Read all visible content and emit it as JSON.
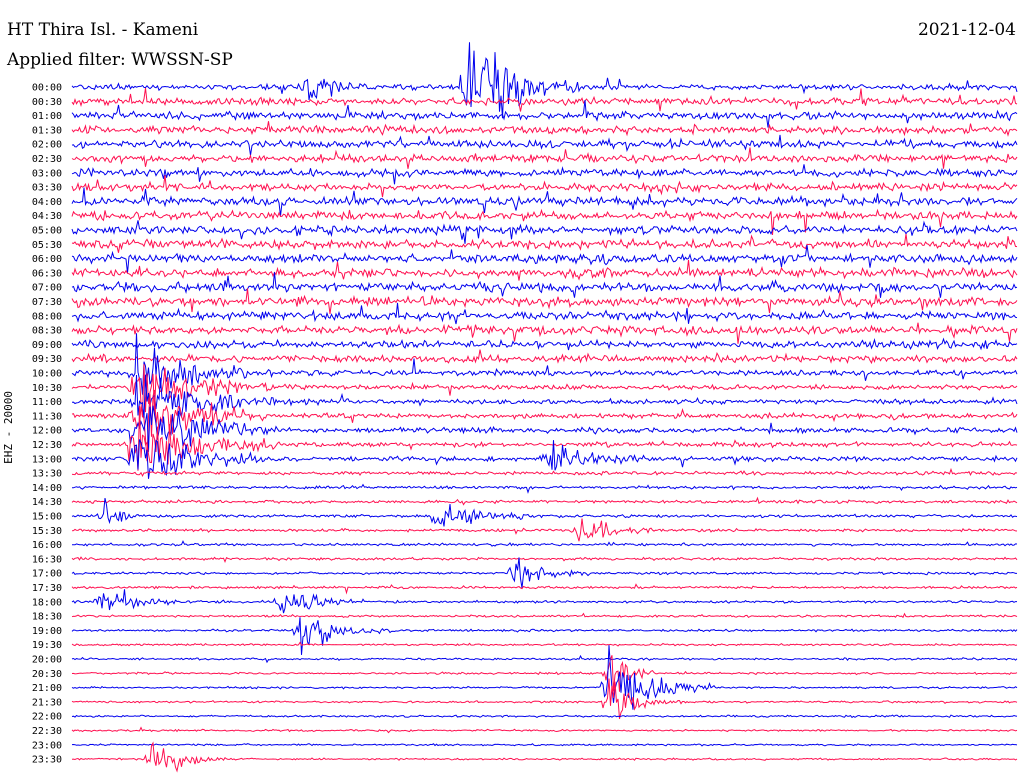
{
  "header": {
    "station": "HT Thira Isl. - Kameni",
    "filter": "Applied filter: WWSSN-SP",
    "date": "2021-12-04",
    "channel_label": "EHZ - 20000"
  },
  "colors": {
    "trace_a": "#0000ee",
    "trace_b": "#ff1050",
    "text": "#000000",
    "background": "#ffffff"
  },
  "chart_data": {
    "type": "line",
    "title": "HT Thira Isl. - Kameni",
    "subtitle": "Applied filter: WWSSN-SP",
    "ylabel": "EHZ - 20000",
    "xlabel": "",
    "row_labels": [
      "00:00",
      "00:30",
      "01:00",
      "01:30",
      "02:00",
      "02:30",
      "03:00",
      "03:30",
      "04:00",
      "04:30",
      "05:00",
      "05:30",
      "06:00",
      "06:30",
      "07:00",
      "07:30",
      "08:00",
      "08:30",
      "09:00",
      "09:30",
      "10:00",
      "10:30",
      "11:00",
      "11:30",
      "12:00",
      "12:30",
      "13:00",
      "13:30",
      "14:00",
      "14:30",
      "15:00",
      "15:30",
      "16:00",
      "16:30",
      "17:00",
      "17:30",
      "18:00",
      "18:30",
      "19:00",
      "19:30",
      "20:00",
      "20:30",
      "21:00",
      "21:30",
      "22:00",
      "22:30",
      "23:00",
      "23:30"
    ],
    "series_colors_alternating": [
      "#0000ee",
      "#ff1050"
    ],
    "noise_level": [
      0.55,
      0.7,
      0.75,
      0.75,
      0.75,
      0.75,
      0.75,
      0.75,
      0.85,
      0.85,
      0.85,
      0.85,
      0.85,
      0.85,
      0.85,
      0.85,
      0.8,
      0.8,
      0.75,
      0.7,
      0.55,
      0.45,
      0.5,
      0.5,
      0.5,
      0.45,
      0.45,
      0.35,
      0.3,
      0.3,
      0.28,
      0.28,
      0.25,
      0.25,
      0.25,
      0.25,
      0.25,
      0.22,
      0.22,
      0.2,
      0.2,
      0.2,
      0.2,
      0.2,
      0.2,
      0.18,
      0.18,
      0.18
    ],
    "events": [
      {
        "row": 0,
        "minute": 12.5,
        "amplitude": 6,
        "duration_min": 1.2
      },
      {
        "row": 0,
        "minute": 7.5,
        "amplitude": 2.5,
        "duration_min": 0.6
      },
      {
        "row": 20,
        "minute": 2.0,
        "amplitude": 3,
        "duration_min": 1.5
      },
      {
        "row": 21,
        "minute": 2.0,
        "amplitude": 3.5,
        "duration_min": 1.5
      },
      {
        "row": 22,
        "minute": 2.0,
        "amplitude": 4,
        "duration_min": 1.5
      },
      {
        "row": 23,
        "minute": 2.0,
        "amplitude": 4,
        "duration_min": 1.5
      },
      {
        "row": 24,
        "minute": 2.0,
        "amplitude": 4.5,
        "duration_min": 1.5
      },
      {
        "row": 25,
        "minute": 2.0,
        "amplitude": 4.5,
        "duration_min": 1.5
      },
      {
        "row": 26,
        "minute": 2.0,
        "amplitude": 3.5,
        "duration_min": 1.5
      },
      {
        "row": 26,
        "minute": 15.0,
        "amplitude": 2,
        "duration_min": 1.2
      },
      {
        "row": 30,
        "minute": 11.5,
        "amplitude": 2,
        "duration_min": 1.0
      },
      {
        "row": 30,
        "minute": 1.0,
        "amplitude": 1.5,
        "duration_min": 0.5
      },
      {
        "row": 31,
        "minute": 16.0,
        "amplitude": 2,
        "duration_min": 0.8
      },
      {
        "row": 34,
        "minute": 14.0,
        "amplitude": 2,
        "duration_min": 0.8
      },
      {
        "row": 36,
        "minute": 0.9,
        "amplitude": 2,
        "duration_min": 0.8
      },
      {
        "row": 36,
        "minute": 6.6,
        "amplitude": 2,
        "duration_min": 0.8
      },
      {
        "row": 38,
        "minute": 7.2,
        "amplitude": 2.5,
        "duration_min": 1.0
      },
      {
        "row": 41,
        "minute": 17.0,
        "amplitude": 3,
        "duration_min": 0.5
      },
      {
        "row": 42,
        "minute": 17.0,
        "amplitude": 4,
        "duration_min": 1.2
      },
      {
        "row": 43,
        "minute": 17.0,
        "amplitude": 3,
        "duration_min": 0.8
      },
      {
        "row": 47,
        "minute": 2.5,
        "amplitude": 2.5,
        "duration_min": 0.8
      }
    ]
  }
}
